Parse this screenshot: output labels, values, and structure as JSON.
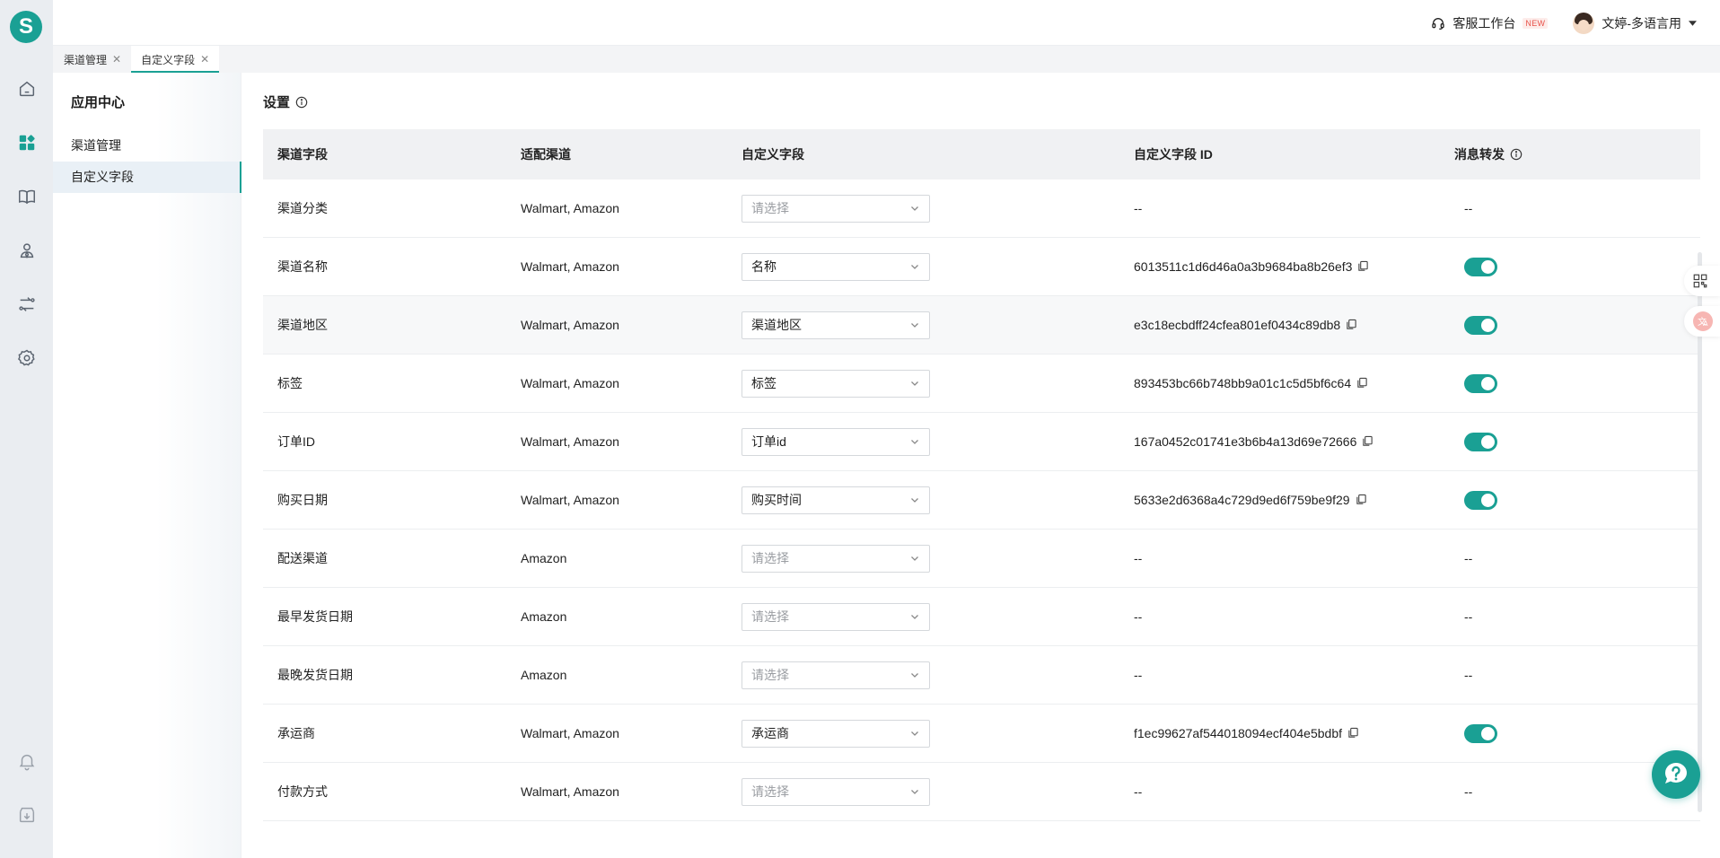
{
  "app": {
    "logo_letter": "S",
    "brand_color": "#1aa094"
  },
  "rail": {
    "icons": [
      "home-icon",
      "apps-icon",
      "book-icon",
      "user-icon",
      "routing-icon",
      "settings-icon",
      "bell-icon",
      "download-icon"
    ],
    "active": "apps-icon"
  },
  "topbar": {
    "workbench_label": "客服工作台",
    "workbench_badge": "NEW",
    "user_name": "文婷-多语言用"
  },
  "tabs": [
    {
      "label": "渠道管理",
      "active": false
    },
    {
      "label": "自定义字段",
      "active": true
    }
  ],
  "subnav": {
    "title": "应用中心",
    "items": [
      {
        "label": "渠道管理",
        "active": false
      },
      {
        "label": "自定义字段",
        "active": true
      }
    ]
  },
  "main": {
    "title": "设置",
    "columns": [
      "渠道字段",
      "适配渠道",
      "自定义字段",
      "自定义字段 ID",
      "消息转发"
    ],
    "rows": [
      {
        "field": "渠道分类",
        "channels": "Walmart, Amazon",
        "custom": "请选择",
        "placeholder": true,
        "id": "--",
        "forward": "--"
      },
      {
        "field": "渠道名称",
        "channels": "Walmart, Amazon",
        "custom": "名称",
        "placeholder": false,
        "id": "6013511c1d6d46a0a3b9684ba8b26ef3",
        "forward": "on"
      },
      {
        "field": "渠道地区",
        "channels": "Walmart, Amazon",
        "custom": "渠道地区",
        "placeholder": false,
        "id": "e3c18ecbdff24cfea801ef0434c89db8",
        "forward": "on",
        "highlight": true
      },
      {
        "field": "标签",
        "channels": "Walmart, Amazon",
        "custom": "标签",
        "placeholder": false,
        "id": "893453bc66b748bb9a01c1c5d5bf6c64",
        "forward": "on"
      },
      {
        "field": "订单ID",
        "channels": "Walmart, Amazon",
        "custom": "订单id",
        "placeholder": false,
        "id": "167a0452c01741e3b6b4a13d69e72666",
        "forward": "on"
      },
      {
        "field": "购买日期",
        "channels": "Walmart, Amazon",
        "custom": "购买时间",
        "placeholder": false,
        "id": "5633e2d6368a4c729d9ed6f759be9f29",
        "forward": "on"
      },
      {
        "field": "配送渠道",
        "channels": "Amazon",
        "custom": "请选择",
        "placeholder": true,
        "id": "--",
        "forward": "--"
      },
      {
        "field": "最早发货日期",
        "channels": "Amazon",
        "custom": "请选择",
        "placeholder": true,
        "id": "--",
        "forward": "--"
      },
      {
        "field": "最晚发货日期",
        "channels": "Amazon",
        "custom": "请选择",
        "placeholder": true,
        "id": "--",
        "forward": "--"
      },
      {
        "field": "承运商",
        "channels": "Walmart, Amazon",
        "custom": "承运商",
        "placeholder": false,
        "id": "f1ec99627af544018094ecf404e5bdbf",
        "forward": "on"
      },
      {
        "field": "付款方式",
        "channels": "Walmart, Amazon",
        "custom": "请选择",
        "placeholder": true,
        "id": "--",
        "forward": "--"
      }
    ]
  },
  "floats": [
    "qr-tool-icon",
    "translate-tool-icon",
    "help-icon"
  ]
}
